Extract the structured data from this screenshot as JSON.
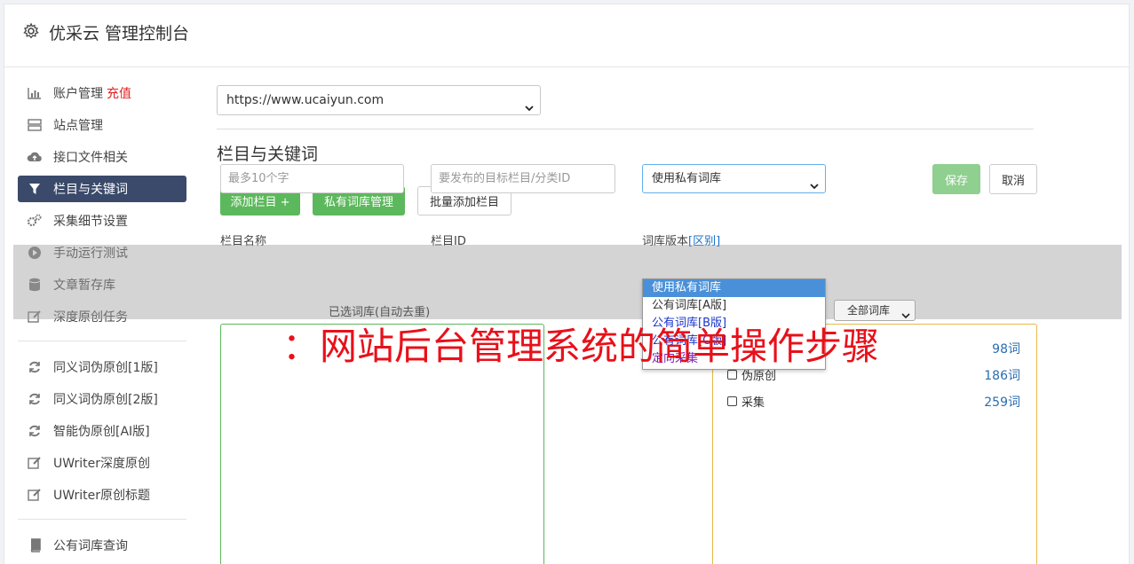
{
  "header": {
    "title": "优采云 管理控制台"
  },
  "sidebar": {
    "items": [
      {
        "label": "账户管理",
        "extra": "充值",
        "icon": "bar-chart-icon"
      },
      {
        "label": "站点管理",
        "icon": "server-icon"
      },
      {
        "label": "接口文件相关",
        "icon": "cloud-upload-icon"
      },
      {
        "label": "栏目与关键词",
        "icon": "filter-icon",
        "active": true
      },
      {
        "label": "采集细节设置",
        "icon": "cogs-icon"
      },
      {
        "label": "手动运行测试",
        "icon": "play-icon"
      },
      {
        "label": "文章暂存库",
        "icon": "database-icon"
      },
      {
        "label": "深度原创任务",
        "icon": "edit-icon"
      }
    ],
    "items2": [
      {
        "label": "同义词伪原创[1版]",
        "icon": "refresh-icon"
      },
      {
        "label": "同义词伪原创[2版]",
        "icon": "refresh-icon"
      },
      {
        "label": "智能伪原创[AI版]",
        "icon": "refresh-icon"
      },
      {
        "label": "UWriter深度原创",
        "icon": "edit-icon"
      },
      {
        "label": "UWriter原创标题",
        "icon": "edit-icon"
      }
    ],
    "items3": [
      {
        "label": "公有词库查询",
        "icon": "book-icon"
      }
    ]
  },
  "main": {
    "site_select": "https://www.ucaiyun.com",
    "section_title": "栏目与关键词",
    "buttons": {
      "add_column": "添加栏目 +",
      "private_lib": "私有词库管理",
      "batch_add": "批量添加栏目"
    },
    "form": {
      "name_label": "栏目名称",
      "name_placeholder": "最多10个字",
      "id_label": "栏目ID",
      "id_placeholder": "要发布的目标栏目/分类ID",
      "version_label": "词库版本",
      "version_link": "[区别]",
      "version_value": "使用私有词库",
      "save": "保存",
      "cancel": "取消"
    },
    "selected_label": "已选词库(自动去重)",
    "filter_value": "全部词库",
    "libs": [
      {
        "name": "",
        "count": "98词"
      },
      {
        "name": "伪原创",
        "count": "186词"
      },
      {
        "name": "采集",
        "count": "259词"
      }
    ],
    "dropdown_options": [
      "使用私有词库",
      "公有词库[A版]",
      "公有词库[B版]",
      "公有词库[C版]",
      "定向采集"
    ]
  },
  "overlay_text": "：网站后台管理系统的简单操作步骤",
  "colors": {
    "active_nav": "#3b4a6b",
    "green": "#5cb85c",
    "overlay_red": "#e8101a"
  }
}
